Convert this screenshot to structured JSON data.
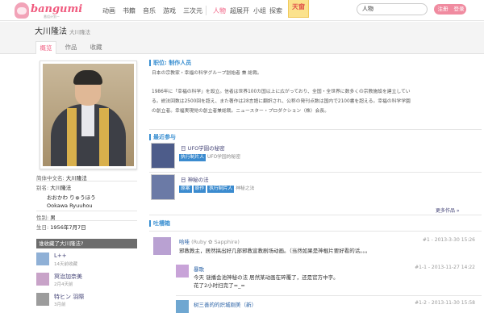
{
  "nav": {
    "logo_text": "bangumi",
    "logo_sub": "番组计划ー",
    "items": [
      "动画",
      "书籍",
      "音乐",
      "游戏",
      "三次元"
    ],
    "right_items": [
      "人物",
      "超展开",
      "小组",
      "探索"
    ],
    "badge": "天窗",
    "search_value": "人物",
    "register": "注册",
    "login": "登录"
  },
  "header": {
    "name": "大川隆法",
    "name_cn": "大川隆法",
    "tabs": [
      "概览",
      "作品",
      "收藏"
    ]
  },
  "infobox": {
    "lines": [
      {
        "k": "简体中文名:",
        "v": "大川隆法"
      },
      {
        "k": "别名:",
        "v": "大川隆法"
      },
      {
        "k": "",
        "v": "おおかわ りゅうほう"
      },
      {
        "k": "",
        "v": "Ookawa Ryuuhou"
      },
      {
        "k": "性别:",
        "v": "男"
      },
      {
        "k": "生日:",
        "v": "1956年7月7日"
      }
    ]
  },
  "fans": {
    "title": "谁收藏了大川隆法?",
    "items": [
      {
        "name": "L++",
        "time": "14天前收藏",
        "color": "#8fb0d6"
      },
      {
        "name": "冥治加奈美",
        "time": "2月4天前",
        "color": "#c8a3c8"
      },
      {
        "name": "特ヒン 羽際",
        "time": "3月前",
        "color": "#9c9c9c"
      }
    ]
  },
  "summary": {
    "title": "职位: 制作人员",
    "p1": "日本の宗教家・幸福の科学グループ創始者 兼 総裁。",
    "p2a": "1986年に「幸福の科学」を設立。信者は世界100カ国以上に広がっており、全国・全世界に数多くの宗教施設を建立してい",
    "p2b": "る。説法回数は2500回を超え、また著作は28言語に翻訳され、公称の発刊点数は国内で2100書を超える。幸福の科学学園",
    "p2c": "の創立者。幸福実現党の創立者兼総裁。ニュースター・プロダクション（株）会長。"
  },
  "works": {
    "title": "最近参与",
    "items": [
      {
        "title": "日 UFO学園の秘密",
        "tags": [
          "执行制片人"
        ],
        "extra": "UFO学园的秘密",
        "color": "#4d5c8a"
      },
      {
        "title": "日 神秘の法",
        "tags": [
          "原案",
          "原作",
          "执行制片人"
        ],
        "extra": "神秘之法",
        "color": "#6b7aa6"
      }
    ],
    "more": "更多作品 »"
  },
  "comments": {
    "title": "吐槽箱",
    "items": [
      {
        "name": "哈哇",
        "sig": "(Ruby ✿ Sapphire)",
        "meta": "#1 - 2013-3-30 15:26",
        "text": "邪教教主，居然搞出好几部邪教宣教剧场动画。（当然如果是神棍片要好看的话。。。"
      },
      {
        "name": "暴歌",
        "meta": "#1-1 - 2013-11-27 14:22",
        "text": "今天 谜播会池神秘の法 居然某动画在碎覆了，还是官方中字。",
        "text2": "花了2小时扫完了=_=",
        "reply": true
      },
      {
        "name": "树三善的的炽城刚美（新）",
        "meta": "#1-2 - 2013-11-30 15:58",
        "reply": true
      }
    ]
  }
}
